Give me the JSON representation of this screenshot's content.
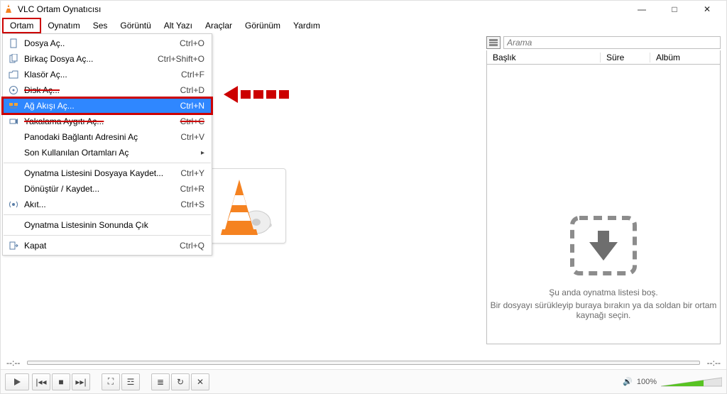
{
  "window": {
    "title": "VLC Ortam Oynatıcısı"
  },
  "menubar": [
    "Ortam",
    "Oynatım",
    "Ses",
    "Görüntü",
    "Alt Yazı",
    "Araçlar",
    "Görünüm",
    "Yardım"
  ],
  "dropdown": {
    "groups": [
      [
        {
          "icon": "file",
          "label": "Dosya Aç..",
          "shortcut": "Ctrl+O",
          "state": "normal"
        },
        {
          "icon": "files",
          "label": "Birkaç Dosya Aç...",
          "shortcut": "Ctrl+Shift+O",
          "state": "normal"
        },
        {
          "icon": "folder",
          "label": "Klasör Aç...",
          "shortcut": "Ctrl+F",
          "state": "normal"
        },
        {
          "icon": "disc",
          "label": "Disk Aç...",
          "shortcut": "Ctrl+D",
          "state": "struck"
        },
        {
          "icon": "net",
          "label": "Ağ Akışı Aç...",
          "shortcut": "Ctrl+N",
          "state": "highlight"
        },
        {
          "icon": "cap",
          "label": "Yakalama Aygıtı Aç...",
          "shortcut": "Ctrl+C",
          "state": "struck-cancel"
        },
        {
          "icon": "",
          "label": "Panodaki Bağlantı Adresini Aç",
          "shortcut": "Ctrl+V",
          "state": "normal"
        },
        {
          "icon": "",
          "label": "Son Kullanılan Ortamları Aç",
          "shortcut": "",
          "state": "normal",
          "submenu": true
        }
      ],
      [
        {
          "icon": "",
          "label": "Oynatma Listesini Dosyaya Kaydet...",
          "shortcut": "Ctrl+Y",
          "state": "normal"
        },
        {
          "icon": "",
          "label": "Dönüştür / Kaydet...",
          "shortcut": "Ctrl+R",
          "state": "normal"
        },
        {
          "icon": "stream",
          "label": "Akıt...",
          "shortcut": "Ctrl+S",
          "state": "normal"
        }
      ],
      [
        {
          "icon": "",
          "label": "Oynatma Listesinin Sonunda Çık",
          "shortcut": "",
          "state": "normal"
        }
      ],
      [
        {
          "icon": "quit",
          "label": "Kapat",
          "shortcut": "Ctrl+Q",
          "state": "normal"
        }
      ]
    ]
  },
  "playlist": {
    "search_placeholder": "Arama",
    "columns": [
      "Başlık",
      "Süre",
      "Albüm"
    ],
    "empty_line1": "Şu anda oynatma listesi boş.",
    "empty_line2": "Bir dosyayı sürükleyip buraya bırakın ya da soldan bir ortam kaynağı seçin."
  },
  "status": {
    "left_time": "--:--",
    "right_time": "--:--"
  },
  "volume": {
    "percent_label": "100%"
  }
}
